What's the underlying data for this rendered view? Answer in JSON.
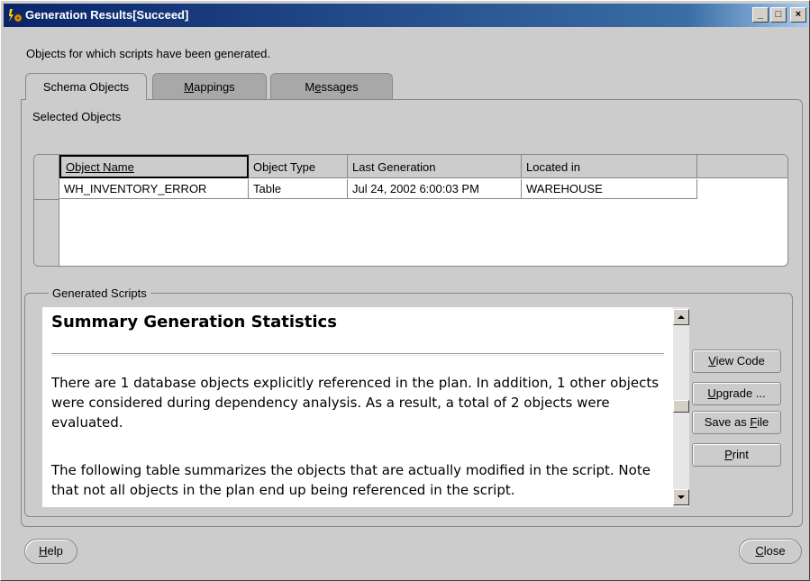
{
  "window": {
    "title": "Generation Results[Succeed]",
    "controls": {
      "minimize": "_",
      "maximize": "□",
      "close": "×"
    }
  },
  "subtitle": "Objects for which scripts have been generated.",
  "tabs": [
    {
      "label": "Schema Objects",
      "active": true
    },
    {
      "label_pre": "",
      "label_key": "M",
      "label_post": "appings",
      "active": false
    },
    {
      "label_pre": "M",
      "label_key": "e",
      "label_post": "ssages",
      "active": false
    }
  ],
  "selected_objects": {
    "label": "Selected Objects",
    "columns": [
      "Object Name",
      "Object Type",
      "Last Generation",
      "Located in"
    ],
    "rows": [
      [
        "WH_INVENTORY_ERROR",
        "Table",
        "Jul 24, 2002 6:00:03 PM",
        "WAREHOUSE"
      ]
    ]
  },
  "generated_scripts": {
    "label": "Generated Scripts",
    "heading": "Summary Generation Statistics",
    "paragraph1": "There are 1 database objects explicitly referenced in the plan. In addition, 1 other objects were considered during dependency analysis. As a result, a total of 2 objects were evaluated.",
    "paragraph2": "The following table summarizes the objects that are actually modified in the script. Note that not all objects in the plan end up being referenced in the script."
  },
  "side_buttons": {
    "view_code": {
      "pre": "",
      "key": "V",
      "post": "iew Code"
    },
    "upgrade": {
      "pre": "",
      "key": "U",
      "post": "pgrade ..."
    },
    "save_as_file": {
      "pre": "Save as ",
      "key": "F",
      "post": "ile"
    },
    "print": {
      "pre": "",
      "key": "P",
      "post": "rint"
    }
  },
  "footer": {
    "help": {
      "key": "H",
      "post": "elp"
    },
    "close": {
      "key": "C",
      "post": "lose"
    }
  },
  "colors": {
    "titlebar_start": "#0a246a",
    "titlebar_end": "#a6caf0",
    "background": "#cccccc"
  }
}
